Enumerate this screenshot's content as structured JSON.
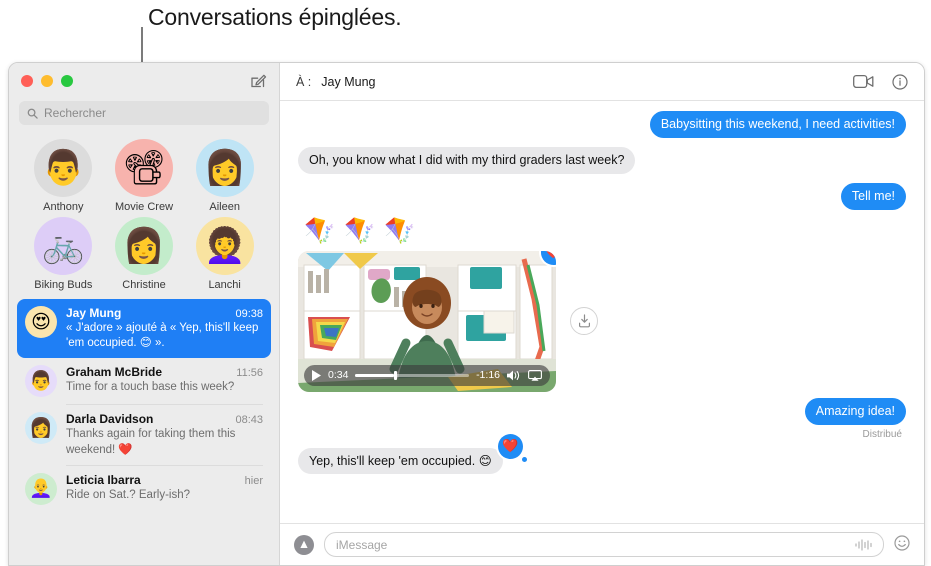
{
  "annotation": {
    "label": "Conversations épinglées."
  },
  "window": {
    "traffic_lights": [
      "close",
      "minimize",
      "maximize"
    ],
    "compose_icon": "compose-pencil-icon"
  },
  "sidebar": {
    "search": {
      "placeholder": "Rechercher",
      "icon": "search-icon"
    },
    "pinned": [
      {
        "name": "Anthony",
        "glyph": "👨",
        "bg": "#dcdcdc"
      },
      {
        "name": "Movie Crew",
        "glyph": "📽",
        "bg": "#f7b3ad"
      },
      {
        "name": "Aileen",
        "glyph": "👩",
        "bg": "#bfe4f5"
      },
      {
        "name": "Biking Buds",
        "glyph": "🚲",
        "bg": "#ddcdf7"
      },
      {
        "name": "Christine",
        "glyph": "👩",
        "bg": "#c3eccb"
      },
      {
        "name": "Lanchi",
        "glyph": "👩‍🦱",
        "bg": "#f9e3a0"
      }
    ],
    "conversations": [
      {
        "name": "Jay Mung",
        "time": "09:38",
        "preview": "« J'adore » ajouté à « Yep, this'll keep 'em occupied. 😊 ».",
        "glyph": "😍",
        "bg": "#fae5ae",
        "selected": true
      },
      {
        "name": "Graham McBride",
        "time": "11:56",
        "preview": "Time for a touch base this week?",
        "glyph": "👨",
        "bg": "#e6dcfa",
        "selected": false
      },
      {
        "name": "Darla Davidson",
        "time": "08:43",
        "preview": "Thanks again for taking them this weekend! ❤️",
        "glyph": "👩",
        "bg": "#cfeaf7",
        "selected": false
      },
      {
        "name": "Leticia Ibarra",
        "time": "hier",
        "preview": "Ride on Sat.? Early-ish?",
        "glyph": "👩‍🦲",
        "bg": "#cdeccf",
        "selected": false
      }
    ]
  },
  "thread": {
    "to_label": "À :",
    "recipient": "Jay Mung",
    "header_icons": [
      "facetime-video-icon",
      "info-icon"
    ],
    "messages": [
      {
        "direction": "out",
        "text": "Babysitting this weekend, I need activities!"
      },
      {
        "direction": "in",
        "text": "Oh, you know what I did with my third graders last week?"
      },
      {
        "direction": "out",
        "text": "Tell me!"
      }
    ],
    "kites": "🪁🪁🪁",
    "video": {
      "elapsed": "0:34",
      "remaining": "-1:16",
      "progress_percent": 34,
      "play_icon": "play-icon",
      "volume_icon": "volume-icon",
      "airplay_icon": "airplay-icon",
      "tapback": "❤️",
      "share_icon": "share-icon"
    },
    "closing_messages": [
      {
        "direction": "out",
        "text": "Amazing idea!"
      }
    ],
    "delivered_label": "Distribué",
    "reply_message": {
      "direction": "in",
      "text": "Yep, this'll keep 'em occupied. 😊",
      "tapback": "❤️"
    }
  },
  "composer": {
    "apps_icon": "app-store-icon",
    "placeholder": "iMessage",
    "audio_icon": "audio-waveform-icon",
    "emoji_icon": "emoji-smiley-icon",
    "emoji_glyph": "☺"
  },
  "colors": {
    "imessage_blue": "#1f8cf5",
    "bubble_gray": "#e8e8ea",
    "selected_row": "#1f7ff5",
    "sidebar_bg": "#ececec"
  }
}
